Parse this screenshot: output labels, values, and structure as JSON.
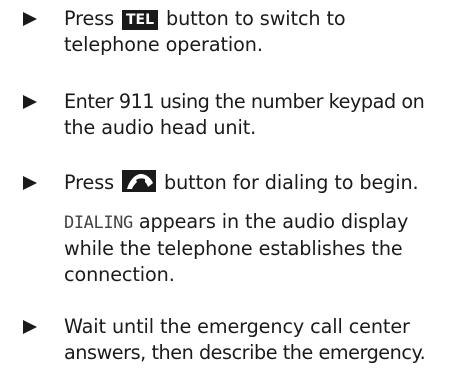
{
  "steps": [
    {
      "line1_before": "Press",
      "key_label": "TEL",
      "line1_after": "button to switch to",
      "line2": "telephone operation."
    },
    {
      "line1": "Enter 911 using the number keypad on",
      "line2": "the audio head unit."
    },
    {
      "line1_before": "Press",
      "line1_after": "button for dialing to begin."
    },
    {
      "line1": "Wait until the emergency call center",
      "line2": "answers, then describe the emergency."
    }
  ],
  "note": {
    "display_text": "DIALING",
    "line1_after": "appears in the audio display",
    "line2": "while the telephone establishes the",
    "line3": "connection."
  },
  "icons": {
    "bullet": "triangle-bullet-icon",
    "tel_key": "tel-button-icon",
    "phone_key": "phone-handset-icon"
  },
  "colors": {
    "text": "#1a1a1a",
    "key_background": "#1a1a1a",
    "key_text": "#ffffff",
    "display_text": "#444444"
  }
}
